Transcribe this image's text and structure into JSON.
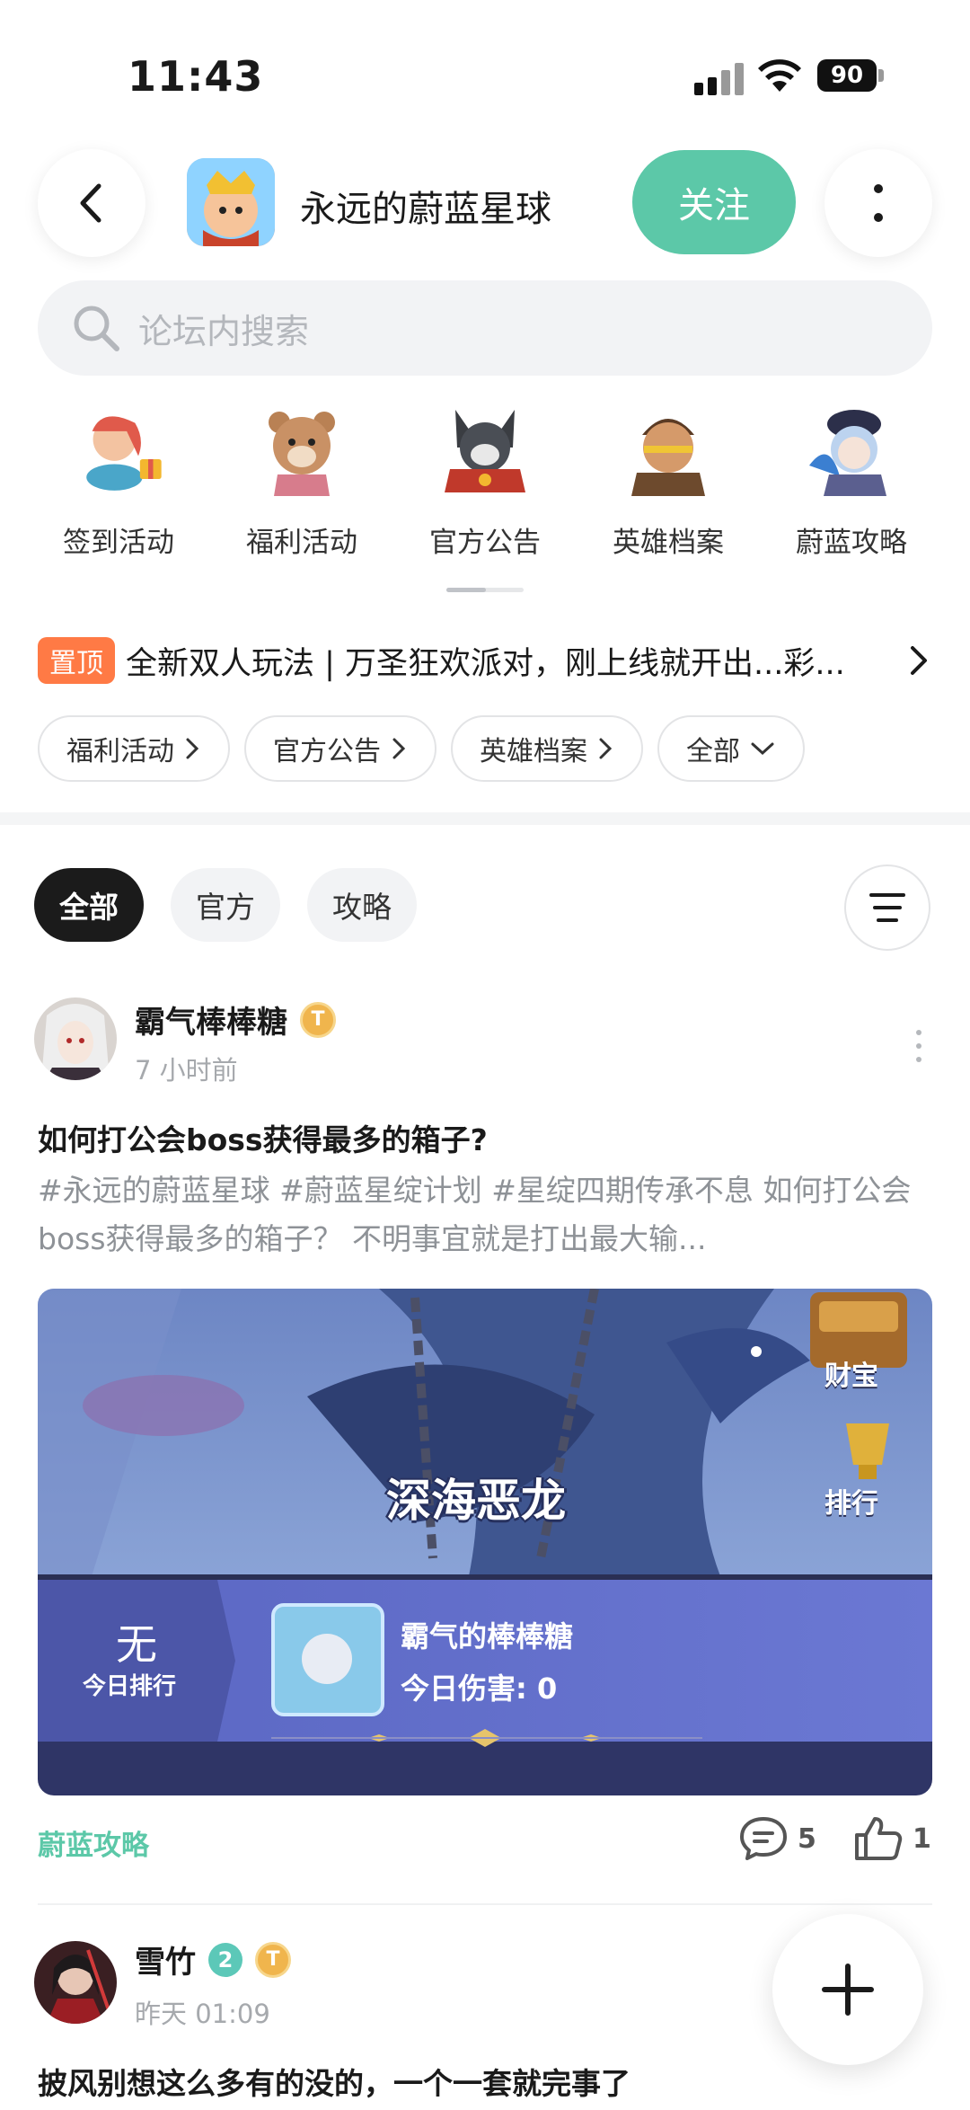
{
  "status_bar": {
    "time": "11:43",
    "battery": "90"
  },
  "header": {
    "game_title": "永远的蔚蓝星球",
    "follow_label": "关注"
  },
  "search": {
    "placeholder": "论坛内搜索"
  },
  "categories": [
    {
      "label": "签到活动",
      "icon": "sign-in-event-icon"
    },
    {
      "label": "福利活动",
      "icon": "welfare-event-icon"
    },
    {
      "label": "官方公告",
      "icon": "official-announcement-icon"
    },
    {
      "label": "英雄档案",
      "icon": "hero-archive-icon"
    },
    {
      "label": "蔚蓝攻略",
      "icon": "guide-icon"
    }
  ],
  "pinned": {
    "badge": "置顶",
    "text": "全新双人玩法 | 万圣狂欢派对，刚上线就开出...彩..."
  },
  "chips": [
    {
      "label": "福利活动"
    },
    {
      "label": "官方公告"
    },
    {
      "label": "英雄档案"
    },
    {
      "label": "全部"
    }
  ],
  "filter_tabs": [
    {
      "label": "全部",
      "active": true
    },
    {
      "label": "官方",
      "active": false
    },
    {
      "label": "攻略",
      "active": false
    }
  ],
  "posts": [
    {
      "author": "霸气棒棒糖",
      "time": "7 小时前",
      "title": "如何打公会boss获得最多的箱子?",
      "excerpt": "#永远的蔚蓝星球 #蔚蓝星绽计划 #星绽四期传承不息   如何打公会boss获得最多的箱子？   不明事宜就是打出最大输...",
      "image": {
        "boss_name": "深海恶龙",
        "treasure_label": "财宝",
        "rank_label": "排行",
        "rank_value": "无",
        "rank_caption": "今日排行",
        "player_name": "霸气的棒棒糖",
        "damage_label": "今日伤害: 0"
      },
      "tag": "蔚蓝攻略",
      "comments": "5",
      "likes": "1"
    },
    {
      "author": "雪竹",
      "verified_level": "2",
      "time": "昨天 01:09",
      "title": "披风别想这么多有的没的，一个一套就完事了"
    }
  ],
  "colors": {
    "accent": "#5cc8a8",
    "pin": "#ff7a45"
  }
}
